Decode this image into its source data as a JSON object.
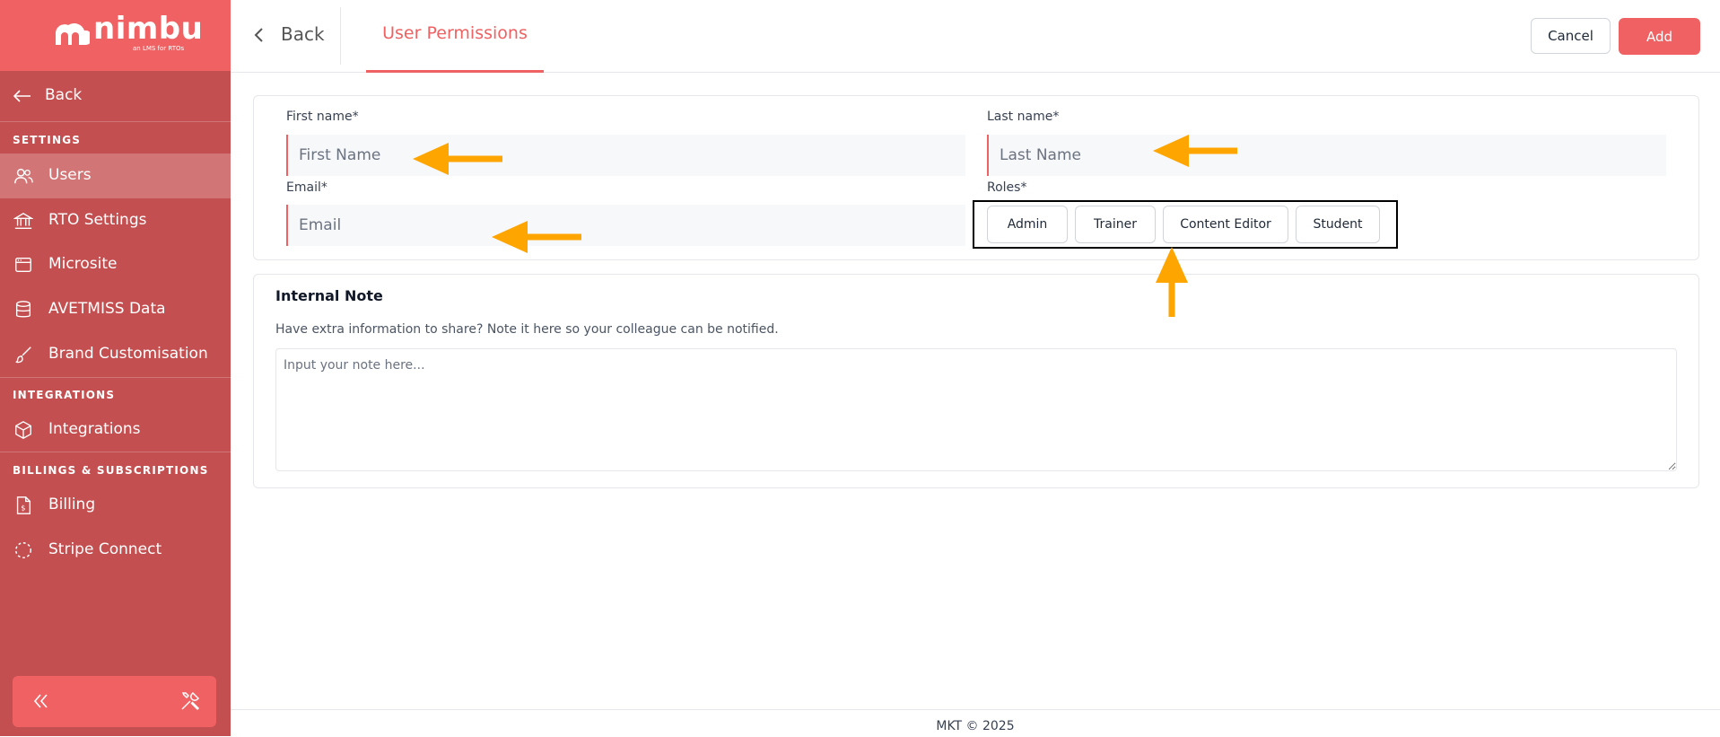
{
  "brand": {
    "name": "nimbu",
    "tagline": "an LMS for RTOs",
    "accent": "#ef6162",
    "sidebar_color": "#c44f50",
    "highlight_arrow_color": "#ffa500"
  },
  "sidebar": {
    "back_label": "Back",
    "sections": [
      {
        "title": "SETTINGS",
        "items": [
          {
            "label": "Users",
            "icon": "users-icon",
            "active": true
          },
          {
            "label": "RTO Settings",
            "icon": "bank-icon"
          },
          {
            "label": "Microsite",
            "icon": "browser-window-icon"
          },
          {
            "label": "AVETMISS Data",
            "icon": "database-icon"
          },
          {
            "label": "Brand Customisation",
            "icon": "paintbrush-icon"
          }
        ]
      },
      {
        "title": "INTEGRATIONS",
        "items": [
          {
            "label": "Integrations",
            "icon": "cube-icon"
          }
        ]
      },
      {
        "title": "BILLINGS & SUBSCRIPTIONS",
        "items": [
          {
            "label": "Billing",
            "icon": "invoice-dollar-icon"
          },
          {
            "label": "Stripe Connect",
            "icon": "dashed-circle-icon"
          }
        ]
      }
    ],
    "collapse_icon": "double-chevron-left-icon",
    "tools_icon": "tools-icon"
  },
  "topbar": {
    "back_label": "Back",
    "active_tab": "User Permissions",
    "cancel_label": "Cancel",
    "add_label": "Add"
  },
  "form": {
    "first_name": {
      "label": "First name*",
      "placeholder": "First Name",
      "value": ""
    },
    "last_name": {
      "label": "Last name*",
      "placeholder": "Last Name",
      "value": ""
    },
    "email": {
      "label": "Email*",
      "placeholder": "Email",
      "value": ""
    },
    "roles": {
      "label": "Roles*",
      "options": [
        "Admin",
        "Trainer",
        "Content Editor",
        "Student"
      ]
    }
  },
  "note": {
    "title": "Internal Note",
    "help": "Have extra information to share? Note it here so your colleague can be notified.",
    "placeholder": "Input your note here..."
  },
  "footer": {
    "text": "MKT © 2025"
  }
}
